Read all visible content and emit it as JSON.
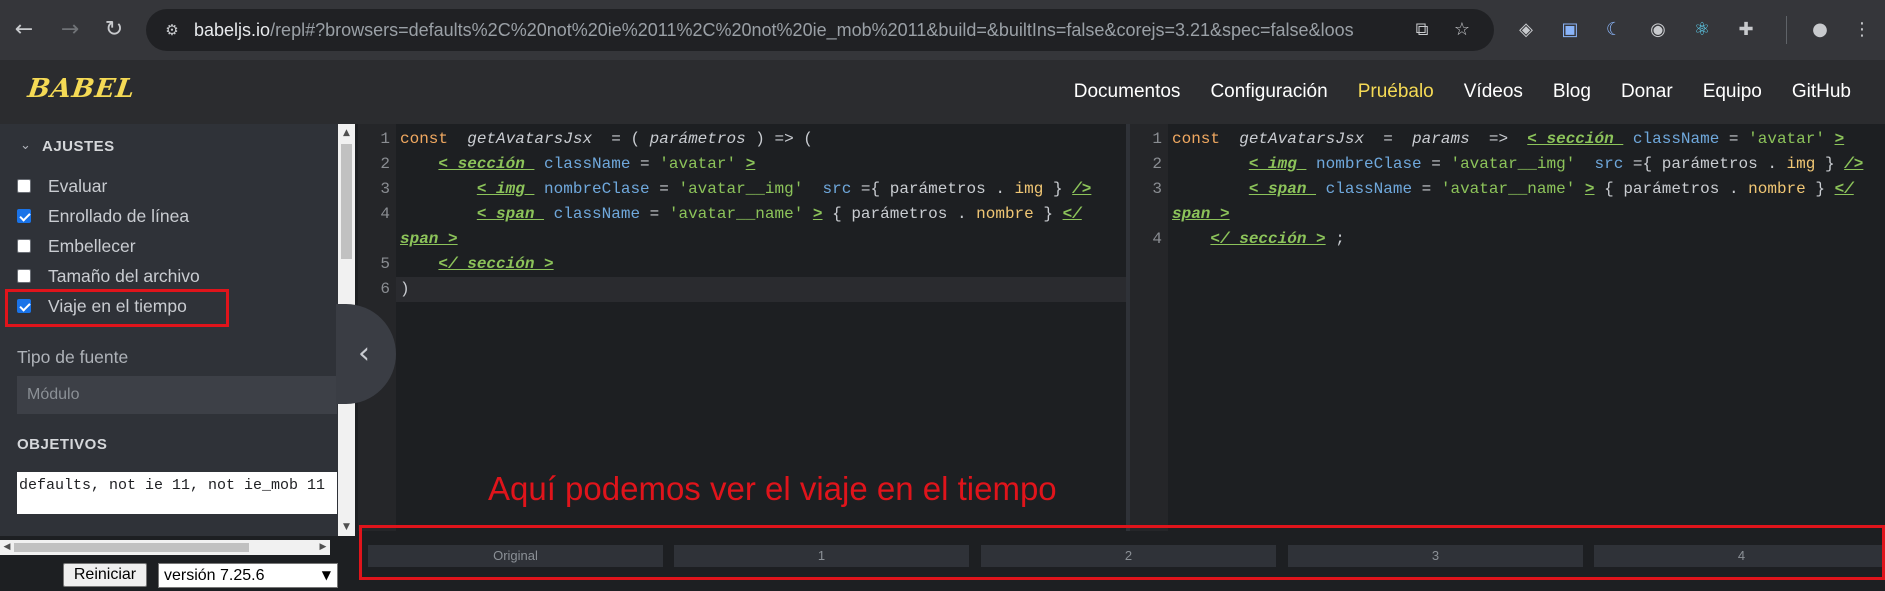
{
  "browser": {
    "url_domain": "babeljs.io",
    "url_rest": "/repl#?browsers=defaults%2C%20not%20ie%2011%2C%20not%20ie_mob%2011&build=&builtIns=false&corejs=3.21&spec=false&loose=false...",
    "icons": [
      "back-icon",
      "forward-icon",
      "reload-icon",
      "site-settings-icon",
      "translate-icon",
      "bookmark-star-icon",
      "extension-icons",
      "profile-icon",
      "menu-icon"
    ]
  },
  "header": {
    "logo": "BABEL",
    "nav": [
      {
        "label": "Documentos",
        "active": false
      },
      {
        "label": "Configuración",
        "active": false
      },
      {
        "label": "Pruébalo",
        "active": true
      },
      {
        "label": "Vídeos",
        "active": false
      },
      {
        "label": "Blog",
        "active": false
      },
      {
        "label": "Donar",
        "active": false
      },
      {
        "label": "Equipo",
        "active": false
      },
      {
        "label": "GitHub",
        "active": false
      }
    ],
    "accent_color": "#f5da55"
  },
  "sidebar": {
    "settings_title": "AJUSTES",
    "options": [
      {
        "label": "Evaluar",
        "checked": false
      },
      {
        "label": "Enrollado de línea",
        "checked": true
      },
      {
        "label": "Embellecer",
        "checked": false
      },
      {
        "label": "Tamaño del archivo",
        "checked": false
      },
      {
        "label": "Viaje en el tiempo",
        "checked": true
      }
    ],
    "source_type_label": "Tipo de fuente",
    "source_type_value": "Módulo",
    "targets_title": "OBJETIVOS",
    "targets_value": "defaults, not ie 11, not ie_mob 11",
    "reset_label": "Reiniciar",
    "version_value": "versión 7.25.6"
  },
  "input_editor": {
    "line_numbers": [
      "1",
      "2",
      "3",
      "4",
      "",
      "5",
      "6"
    ]
  },
  "output_editor": {
    "line_numbers": [
      "1",
      "2",
      "3",
      "",
      "4"
    ]
  },
  "time_travel": {
    "steps": [
      "Original",
      "1",
      "2",
      "3",
      "4"
    ]
  },
  "annotation": {
    "text": "Aquí podemos ver el viaje en el tiempo",
    "color": "#e0141b"
  }
}
